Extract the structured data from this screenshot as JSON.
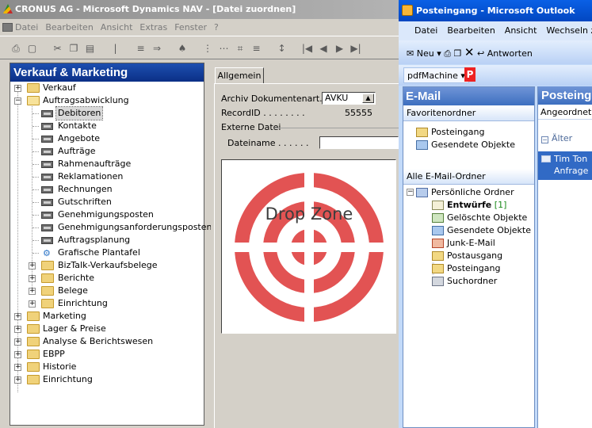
{
  "nav": {
    "title": "CRONUS AG - Microsoft Dynamics NAV - [Datei zuordnen]",
    "menu": [
      "Datei",
      "Bearbeiten",
      "Ansicht",
      "Extras",
      "Fenster",
      "?"
    ],
    "tree": {
      "header": "Verkauf & Marketing",
      "nodes": [
        {
          "label": "Verkauf"
        },
        {
          "label": "Auftragsabwicklung"
        },
        {
          "label": "Debitoren"
        },
        {
          "label": "Kontakte"
        },
        {
          "label": "Angebote"
        },
        {
          "label": "Aufträge"
        },
        {
          "label": "Rahmenaufträge"
        },
        {
          "label": "Reklamationen"
        },
        {
          "label": "Rechnungen"
        },
        {
          "label": "Gutschriften"
        },
        {
          "label": "Genehmigungsposten"
        },
        {
          "label": "Genehmigungsanforderungsposten"
        },
        {
          "label": "Auftragsplanung"
        },
        {
          "label": "Grafische Plantafel"
        },
        {
          "label": "BizTalk-Verkaufsbelege"
        },
        {
          "label": "Berichte"
        },
        {
          "label": "Belege"
        },
        {
          "label": "Einrichtung"
        },
        {
          "label": "Marketing"
        },
        {
          "label": "Lager & Preise"
        },
        {
          "label": "Analyse & Berichtswesen"
        },
        {
          "label": "EBPP"
        },
        {
          "label": "Historie"
        },
        {
          "label": "Einrichtung"
        }
      ]
    },
    "form": {
      "tab": "Allgemein",
      "archiv_label": "Archiv Dokumentenart. .",
      "archiv_value": "AVKU",
      "record_label": "RecordID . . . . . . . .",
      "record_value": "55555",
      "externe_label": "Externe Datei",
      "dateiname_label": "Dateiname . . . . . .",
      "dateiname_value": "",
      "dropzone_text": "Drop Zone"
    }
  },
  "outlook": {
    "title": "Posteingang - Microsoft Outlook",
    "menu": [
      "Datei",
      "Bearbeiten",
      "Ansicht",
      "Wechseln zu"
    ],
    "toolbar": {
      "new": "Neu",
      "reply": "Antworten"
    },
    "pdf": "pdfMachine",
    "mail": {
      "header": "E-Mail",
      "favorites_header": "Favoritenordner",
      "favorites": [
        "Posteingang",
        "Gesendete Objekte"
      ],
      "all_header": "Alle E-Mail-Ordner",
      "root": "Persönliche Ordner",
      "folders": [
        {
          "label": "Entwürfe",
          "count": "[1]"
        },
        {
          "label": "Gelöschte Objekte"
        },
        {
          "label": "Gesendete Objekte"
        },
        {
          "label": "Junk-E-Mail"
        },
        {
          "label": "Postausgang"
        },
        {
          "label": "Posteingang"
        },
        {
          "label": "Suchordner"
        }
      ]
    },
    "list": {
      "header": "Posteing",
      "sub": "Angeordnet n",
      "group": "Älter",
      "msg_line1": "Tim Ton",
      "msg_line2": "Anfrage"
    }
  }
}
